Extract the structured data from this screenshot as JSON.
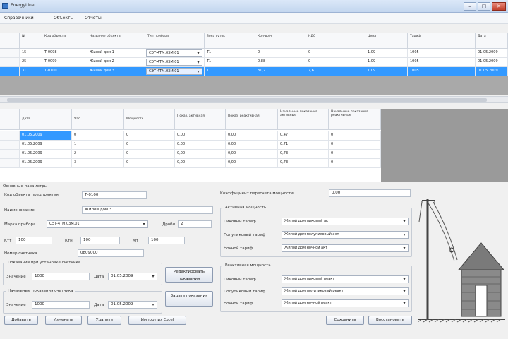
{
  "window": {
    "title": "EnergyLine",
    "min_glyph": "–",
    "max_glyph": "□",
    "close_glyph": "✕"
  },
  "menu": [
    "Справочники",
    "Объекты",
    "Отчеты"
  ],
  "grid1": {
    "headers": [
      "",
      "№",
      "Код объекта",
      "Название объекта",
      "Тип прибора",
      "Зона суток",
      "Кол-во/ч",
      "НДС",
      "Цена",
      "Тариф",
      "Дата"
    ],
    "rows": [
      {
        "cells": [
          "",
          "15",
          "Т-0098",
          "Жилой дом 1",
          "СЭТ-4ТМ.03М.01",
          "Т1",
          "0",
          "0",
          "1,09",
          "1005",
          "01.05.2009"
        ]
      },
      {
        "cells": [
          "",
          "25",
          "Т-0099",
          "Жилой дом 2",
          "СЭТ-4ТМ.03М.01",
          "Т1",
          "0,88",
          "0",
          "1,09",
          "1005",
          "01.05.2009"
        ]
      },
      {
        "cells": [
          "",
          "31",
          "Т-0100",
          "Жилой дом 3",
          "СЭТ-4ТМ.03М.01",
          "Т1",
          "81,2",
          "7,6",
          "1,09",
          "1005",
          "01.05.2009"
        ]
      }
    ]
  },
  "grid2": {
    "headers": [
      "Дата",
      "Час",
      "Мощность",
      "Показ. активная",
      "Показ. реактивная",
      "Начальные показания активные",
      "Начальные показания реактивные"
    ],
    "rows": [
      [
        "01.05.2009",
        "0",
        "0",
        "0,00",
        "0,00",
        "0,47",
        "0"
      ],
      [
        "01.05.2009",
        "1",
        "0",
        "0,00",
        "0,00",
        "0,71",
        "0"
      ],
      [
        "01.05.2009",
        "2",
        "0",
        "0,00",
        "0,00",
        "0,73",
        "0"
      ],
      [
        "01.05.2009",
        "3",
        "0",
        "0,00",
        "0,00",
        "0,73",
        "0"
      ]
    ]
  },
  "form": {
    "section_title": "Основные параметры",
    "code_label": "Код объекта предприятия",
    "code_value": "Т-0100",
    "name_label": "Наименование",
    "name_value": "Жилой дом 3",
    "model_label": "Марка прибора",
    "model_value": "СЭТ-4ТМ.03М.01",
    "digits_label": "Дроби",
    "digits_value": "2",
    "ktt_label": "Ктт",
    "ktt_value": "100",
    "ktn_label": "Ктн",
    "ktn_value": "100",
    "kp_label": "Кп",
    "kp_value": "100",
    "serial_label": "Номер счетчика",
    "serial_value": "0809000",
    "install_group": "Показания при установке счетчика",
    "value_label": "Значение",
    "install_value": "1000",
    "date_label": "Дата",
    "install_date": "01.05.2009",
    "initial_group": "Начальные показания счетчика",
    "initial_value": "1000",
    "initial_date": "01.05.2009",
    "btn_edit_install": "Редактировать показания",
    "btn_edit_initial": "Задать показания",
    "calc_label": "Коэффициент пересчета мощности",
    "calc_value": "0,00",
    "active_group": "Активная мощность",
    "reactive_group": "Реактивная мощность",
    "peak_label": "Пиковый тариф",
    "half_label": "Полупиковый тариф",
    "night_label": "Ночной тариф",
    "active_peak": "Жилой дом пиковый акт",
    "active_half": "Жилой дом полупиковый акт",
    "active_night": "Жилой дом ночной акт",
    "reactive_peak": "Жилой дом пиковый реакт",
    "reactive_half": "Жилой дом полупиковый реакт",
    "reactive_night": "Жилой дом ночной реакт"
  },
  "buttons": {
    "add": "Добавить",
    "change": "Изменить",
    "delete": "Удалить",
    "import": "Импорт из Excel",
    "save": "Сохранить",
    "restore": "Восстановить"
  },
  "colors": {
    "selection": "#3399ff",
    "title_bar": "#c3d6ef",
    "grey_panel": "#9a9a9a"
  }
}
